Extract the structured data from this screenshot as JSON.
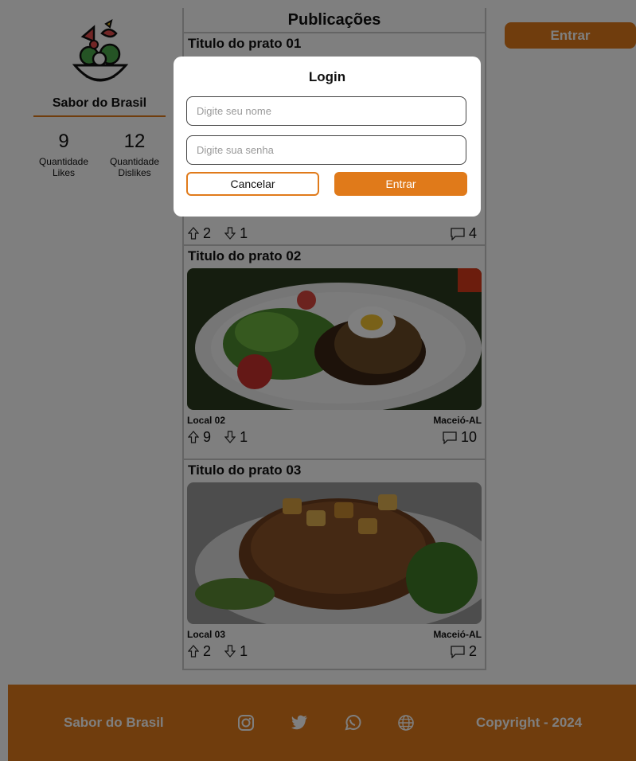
{
  "colors": {
    "accent": "#E07A1A",
    "overlay": "rgba(0,0,0,0.5)"
  },
  "profile": {
    "brand": "Sabor do Brasil",
    "likes": {
      "count": "9",
      "label": "Quantidade Likes"
    },
    "dislikes": {
      "count": "12",
      "label": "Quantidade Dislikes"
    }
  },
  "header": {
    "login_label": "Entrar"
  },
  "feed": {
    "title": "Publicações",
    "posts": [
      {
        "title": "Titulo do prato 01",
        "up": "2",
        "down": "1",
        "comments": "4"
      },
      {
        "title": "Titulo do prato 02",
        "local": "Local 02",
        "city": "Maceió-AL",
        "up": "9",
        "down": "1",
        "comments": "10"
      },
      {
        "title": "Titulo do prato 03",
        "local": "Local 03",
        "city": "Maceió-AL",
        "up": "2",
        "down": "1",
        "comments": "2"
      }
    ]
  },
  "modal": {
    "title": "Login",
    "name_placeholder": "Digite seu nome",
    "password_placeholder": "Digite sua senha",
    "cancel_label": "Cancelar",
    "submit_label": "Entrar"
  },
  "footer": {
    "brand": "Sabor do Brasil",
    "icons": [
      "instagram-icon",
      "twitter-icon",
      "whatsapp-icon",
      "globe-icon"
    ],
    "copyright": "Copyright - 2024"
  }
}
